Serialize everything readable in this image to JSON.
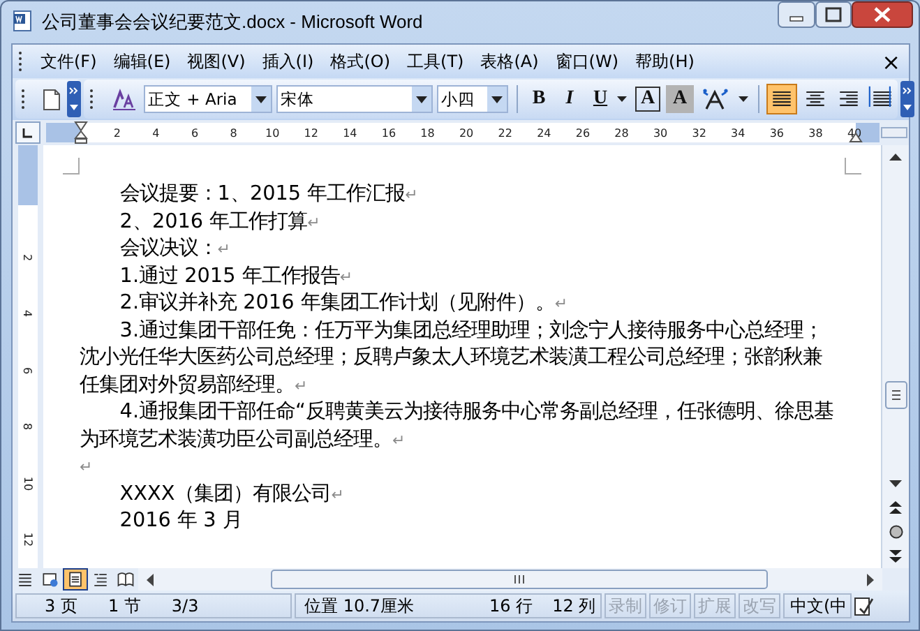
{
  "window": {
    "title": "公司董事会会议纪要范文.docx - Microsoft Word"
  },
  "menu": [
    {
      "label": "文件(F)"
    },
    {
      "label": "编辑(E)"
    },
    {
      "label": "视图(V)"
    },
    {
      "label": "插入(I)"
    },
    {
      "label": "格式(O)"
    },
    {
      "label": "工具(T)"
    },
    {
      "label": "表格(A)"
    },
    {
      "label": "窗口(W)"
    },
    {
      "label": "帮助(H)"
    }
  ],
  "menu_close": "×",
  "toolbar": {
    "style": "正文 + Aria",
    "font": "宋体",
    "size": "小四",
    "format_buttons": [
      {
        "kind": "bold",
        "label": "B"
      },
      {
        "kind": "italic",
        "label": "I"
      },
      {
        "kind": "underline",
        "label": "U"
      },
      {
        "kind": "border",
        "label": "A"
      },
      {
        "kind": "shading",
        "label": "A"
      }
    ],
    "align_buttons": [
      {
        "kind": "justify",
        "selected": true
      },
      {
        "kind": "center",
        "selected": false
      },
      {
        "kind": "right",
        "selected": false
      },
      {
        "kind": "distributed",
        "selected": false
      }
    ]
  },
  "ruler": {
    "marks": [
      "2",
      "4",
      "6",
      "8",
      "10",
      "12",
      "14",
      "16",
      "18",
      "20",
      "22",
      "24",
      "26",
      "28",
      "30",
      "32",
      "34",
      "36",
      "38",
      "40"
    ]
  },
  "vertical_ruler": {
    "marks": [
      "2",
      "4",
      "6",
      "8",
      "10",
      "12"
    ]
  },
  "document": {
    "paragraphs": [
      {
        "text": "会议提要：1、2015 年工作汇报",
        "indent": true,
        "mark": "↵"
      },
      {
        "text": "2、2016 年工作打算",
        "indent": true,
        "mark": "↵"
      },
      {
        "text": "会议决议：",
        "indent": true,
        "mark": "↵"
      },
      {
        "text": "1.通过 2015 年工作报告",
        "indent": true,
        "mark": "↵"
      },
      {
        "text": "2.审议并补充 2016 年集团工作计划（见附件）。",
        "indent": true,
        "mark": "↵"
      },
      {
        "text": "3.通过集团干部任免：任万平为集团总经理助理；刘念宁人接待服务中心总经理；沈小光任华大医药公司总经理；反聘卢象太人环境艺术装潢工程公司总经理；张韵秋兼任集团对外贸易部经理。",
        "indent": true,
        "mark": "↵"
      },
      {
        "text": "4.通报集团干部任命“反聘黄美云为接待服务中心常务副总经理，任张德明、徐思基为环境艺术装潢功臣公司副总经理。",
        "indent": true,
        "mark": "↵"
      },
      {
        "indent": false,
        "mark": "↵"
      },
      {
        "text": "XXXX（集团）有限公司",
        "indent": true,
        "mark": "↵"
      },
      {
        "text": "2016 年 3 月",
        "indent": true
      }
    ]
  },
  "view_buttons": [
    {
      "kind": "normal",
      "selected": false
    },
    {
      "kind": "web",
      "selected": false
    },
    {
      "kind": "print",
      "selected": true
    },
    {
      "kind": "outline",
      "selected": false
    },
    {
      "kind": "reading",
      "selected": false
    }
  ],
  "status_bar": {
    "page": "3 页",
    "section": "1 节",
    "pages": "3/3",
    "position": "位置 10.7厘米",
    "line": "16 行",
    "column": "12 列",
    "modes": [
      {
        "label": "录制",
        "on": false
      },
      {
        "label": "修订",
        "on": false
      },
      {
        "label": "扩展",
        "on": false
      },
      {
        "label": "改写",
        "on": false
      }
    ],
    "language": "中文(中"
  }
}
